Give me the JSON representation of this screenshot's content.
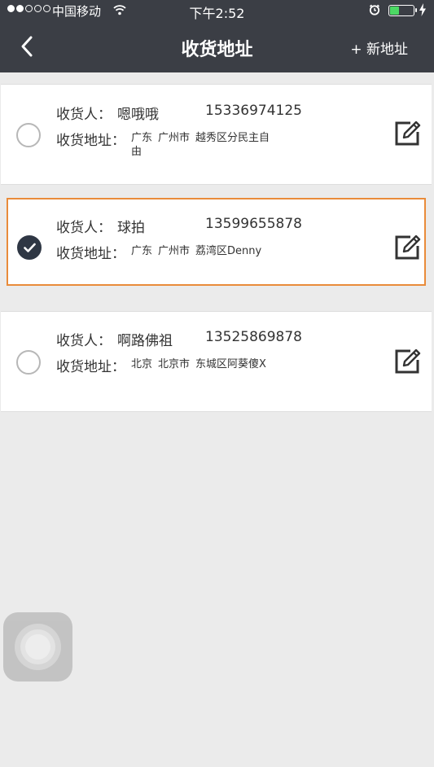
{
  "status_bar": {
    "carrier": "中国移动",
    "time": "下午2:52",
    "signal_strength": 2,
    "battery_level": 0.4
  },
  "nav": {
    "title": "收货地址",
    "add_label": "+ 新地址",
    "back_icon": "chevron-left-icon"
  },
  "labels": {
    "receiver": "收货人：",
    "address": "收货地址："
  },
  "addresses": [
    {
      "name": "嗯哦哦",
      "phone": "15336974125",
      "province": "广东",
      "city": "广州市",
      "detail": "越秀区分民主自由",
      "selected": false
    },
    {
      "name": "球拍",
      "phone": "13599655878",
      "province": "广东",
      "city": "广州市",
      "detail": "荔湾区Denny",
      "selected": true
    },
    {
      "name": "啊路佛祖",
      "phone": "13525869878",
      "province": "北京",
      "city": "北京市",
      "detail": "东城区阿葵傻X",
      "selected": false
    }
  ],
  "colors": {
    "header_bg": "#3b3e45",
    "selected_border": "#e98b3a",
    "check_bg": "#2f3744",
    "page_bg": "#ebebeb"
  }
}
